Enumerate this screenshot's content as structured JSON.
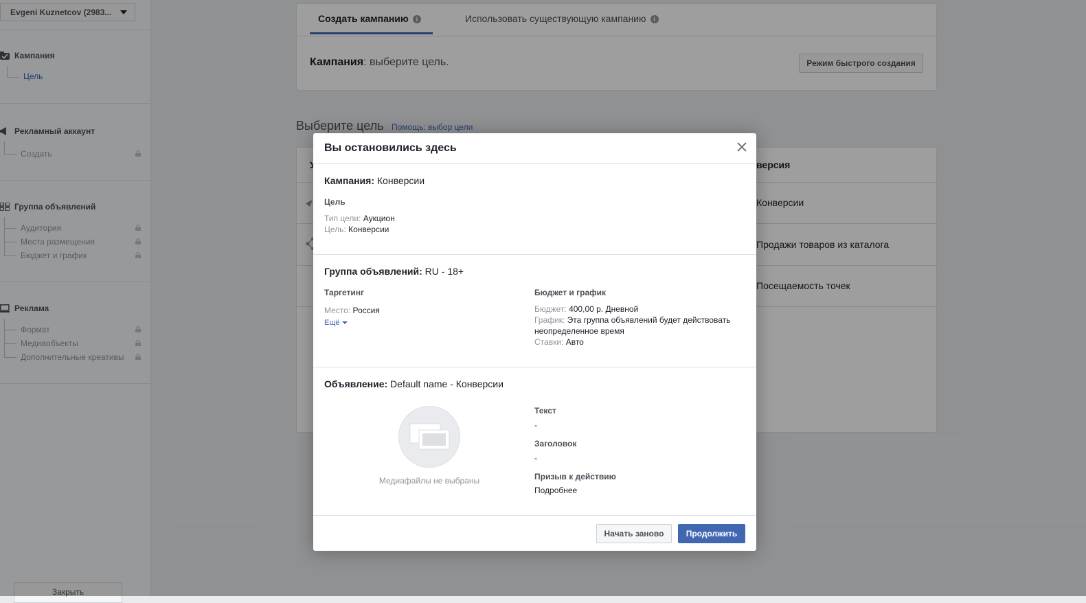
{
  "sidebar": {
    "account": "Evgeni Kuznetcov (2983...",
    "close_label": "Закрыть",
    "sections": [
      {
        "title": "Кампания",
        "items": [
          {
            "label": "Цель",
            "active": true
          }
        ]
      },
      {
        "title": "Рекламный аккаунт",
        "items": [
          {
            "label": "Создать",
            "locked": true
          }
        ]
      },
      {
        "title": "Группа объявлений",
        "items": [
          {
            "label": "Аудитория",
            "locked": true
          },
          {
            "label": "Места размещения",
            "locked": true
          },
          {
            "label": "Бюджет и график",
            "locked": true
          }
        ]
      },
      {
        "title": "Реклама",
        "items": [
          {
            "label": "Формат",
            "locked": true
          },
          {
            "label": "Медиаобъекты",
            "locked": true
          },
          {
            "label": "Дополнительные креативы",
            "locked": true
          }
        ]
      }
    ]
  },
  "main": {
    "tabs": [
      {
        "label": "Создать кампанию",
        "active": true
      },
      {
        "label": "Использовать существующую кампанию",
        "active": false
      }
    ],
    "info_glyph": "i",
    "campaign_label": "Кампания",
    "campaign_hint": ": выберите цель.",
    "quick_mode_button": "Режим быстрого создания",
    "objective_title": "Выберите цель",
    "objective_help": "Помощь: выбор цели",
    "objective_column_head_partial": "версия",
    "objective_column_left_partial": "У",
    "objectives": [
      "Конверсии",
      "Продажи товаров из каталога",
      "Посещаемость точек"
    ]
  },
  "modal": {
    "title": "Вы остановились здесь",
    "campaign": {
      "label": "Кампания:",
      "value": " Конверсии",
      "goal_heading": "Цель",
      "goal_type_key": "Тип цели:",
      "goal_type_value": " Аукцион",
      "goal_key": "Цель:",
      "goal_value": " Конверсии"
    },
    "adset": {
      "label": "Группа объявлений:",
      "value": " RU - 18+",
      "targeting_heading": "Таргетинг",
      "place_key": "Место:",
      "place_value": " Россия",
      "more_link": "Ещё",
      "budget_heading": "Бюджет и график",
      "budget_key": "Бюджет:",
      "budget_value": " 400,00 р. Дневной",
      "schedule_key": "График:",
      "schedule_value": " Эта группа объявлений будет действовать неопределенное время",
      "bids_key": "Ставки:",
      "bids_value": " Авто"
    },
    "ad": {
      "label": "Объявление:",
      "value": " Default name - Конверсии",
      "media_caption": "Медиафайлы не выбраны",
      "text_heading": "Текст",
      "text_value": "-",
      "headline_heading": "Заголовок",
      "headline_value": "-",
      "cta_heading": "Призыв к действию",
      "cta_value": "Подробнее"
    },
    "buttons": {
      "restart": "Начать заново",
      "continue": "Продолжить"
    }
  },
  "colors": {
    "accent": "#4267b2",
    "page_bg": "#e9ebee",
    "overlay": "rgba(0,0,0,0.38)"
  }
}
